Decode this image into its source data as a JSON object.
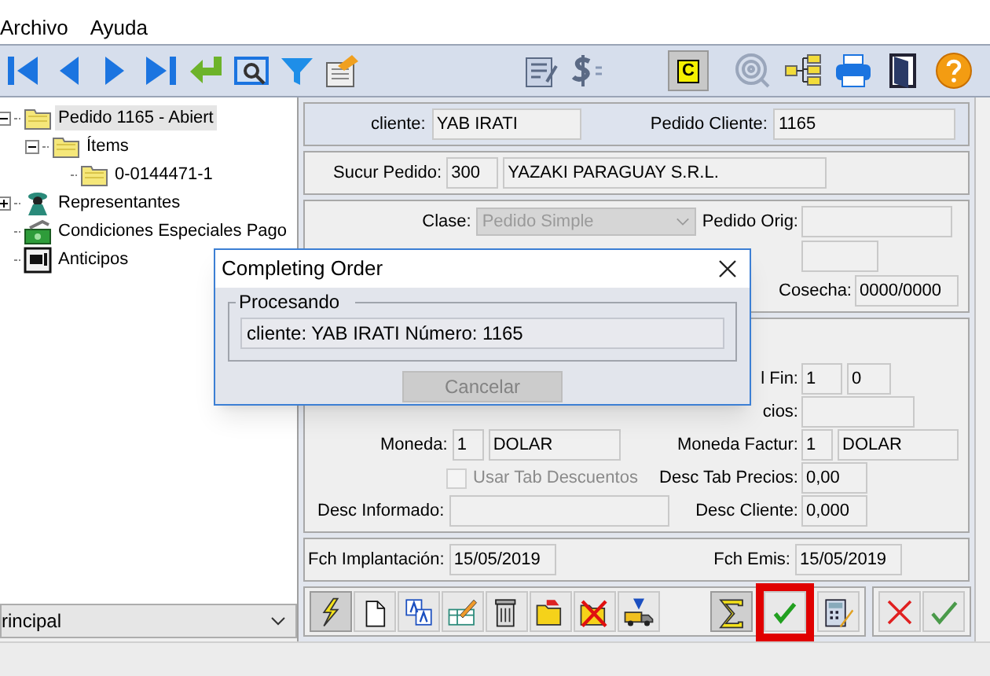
{
  "menu": [
    "Archivo",
    "Ayuda"
  ],
  "toolbar": {
    "toggle": {
      "label": "C",
      "selected": true
    }
  },
  "tree": [
    {
      "kind": "folder",
      "label": "Pedido 1165 - Abiert",
      "selected": true,
      "expanded": true,
      "children": [
        {
          "kind": "folder",
          "label": "Ítems",
          "selected": false,
          "expanded": true,
          "children": [
            {
              "kind": "folder",
              "label": "0-0144471-1",
              "selected": false
            }
          ]
        }
      ]
    },
    {
      "kind": "people",
      "label": "Representantes",
      "selected": false,
      "expanded": false
    },
    {
      "kind": "money",
      "label": "Condiciones Especiales Pago",
      "selected": false
    },
    {
      "kind": "safe",
      "label": "Anticipos",
      "selected": false
    }
  ],
  "view_combo": {
    "value": "rincipal"
  },
  "header": {
    "cliente_label": "cliente:",
    "cliente": "YAB IRATI",
    "pedido_cliente_label": "Pedido Cliente:",
    "pedido_cliente": "1165"
  },
  "sucursal": {
    "label": "Sucur Pedido:",
    "code": "300",
    "name": "YAZAKI PARAGUAY S.R.L."
  },
  "clase": {
    "label": "Clase:",
    "value": "Pedido Simple",
    "disabled": true
  },
  "pedido_orig": {
    "label": "Pedido Orig:"
  },
  "cosecha": {
    "label": "Cosecha:",
    "value": "0000/0000"
  },
  "fin": {
    "label": "l Fin:",
    "value_1": "1",
    "value_2": "0"
  },
  "precios": {
    "label": "cios:"
  },
  "moneda": {
    "label": "Moneda:",
    "code": "1",
    "name": "DOLAR"
  },
  "moneda_factur": {
    "label": "Moneda Factur:",
    "code": "1",
    "name": "DOLAR"
  },
  "usar_tab": {
    "label": "Usar Tab Descuentos",
    "checked": false,
    "disabled": true
  },
  "desc_tab_precios": {
    "label": "Desc Tab Precios:",
    "value": "0,00"
  },
  "desc_informado": {
    "label": "Desc Informado:"
  },
  "desc_cliente": {
    "label": "Desc Cliente:",
    "value": "0,000"
  },
  "fechas": {
    "implantacion_label": "Fch Implantación:",
    "implantacion": "15/05/2019",
    "emision_label": "Fch Emis:",
    "emision": "15/05/2019"
  },
  "action_buttons": [
    {
      "pressed": true,
      "highlighted": false
    },
    {
      "pressed": false,
      "highlighted": false
    },
    {
      "pressed": false,
      "highlighted": false
    },
    {
      "pressed": false,
      "highlighted": false
    },
    {
      "pressed": false,
      "highlighted": false
    },
    {
      "pressed": false,
      "highlighted": false
    },
    {
      "pressed": false,
      "highlighted": false
    },
    {
      "pressed": false,
      "highlighted": false
    },
    {
      "pressed": true,
      "highlighted": false
    },
    {
      "pressed": false,
      "highlighted": true
    },
    {
      "pressed": false,
      "highlighted": false
    },
    {
      "pressed": false,
      "highlighted": false
    },
    {
      "pressed": false,
      "highlighted": false
    }
  ],
  "dialog": {
    "title": "Completing Order",
    "group": "Procesando",
    "message": "cliente: YAB IRATI Número: 1165",
    "button": {
      "label": "Cancelar",
      "disabled": true
    }
  }
}
